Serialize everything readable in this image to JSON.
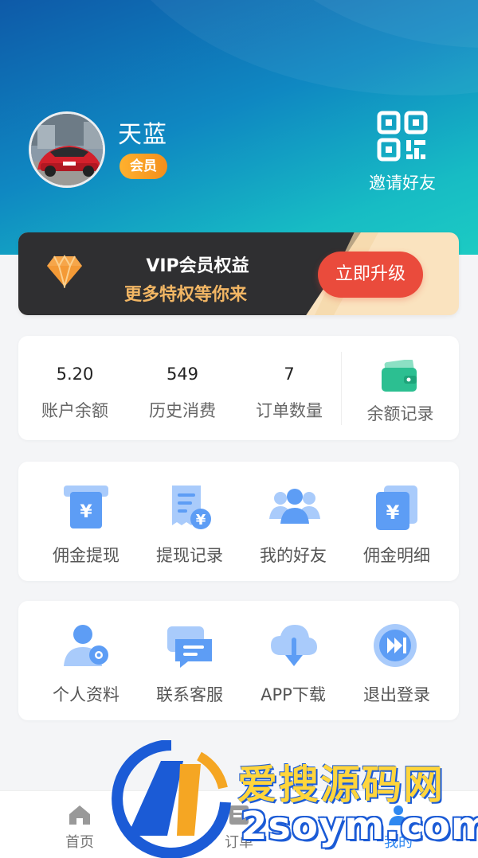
{
  "header": {
    "username": "天蓝",
    "badge": "会员",
    "invite_label": "邀请好友",
    "invite_icon": "qr-code-icon"
  },
  "vip": {
    "title": "VIP会员权益",
    "subtitle": "更多特权等你来",
    "button": "立即升级",
    "icon": "diamond-icon"
  },
  "stats": [
    {
      "value": "5.20",
      "label": "账户余额"
    },
    {
      "value": "549",
      "label": "历史消费"
    },
    {
      "value": "7",
      "label": "订单数量"
    }
  ],
  "balance_record": {
    "label": "余额记录",
    "icon": "wallet-icon"
  },
  "grid1": [
    {
      "label": "佣金提现",
      "icon": "withdraw-icon"
    },
    {
      "label": "提现记录",
      "icon": "receipt-icon"
    },
    {
      "label": "我的好友",
      "icon": "friends-icon"
    },
    {
      "label": "佣金明细",
      "icon": "commission-detail-icon"
    }
  ],
  "grid2": [
    {
      "label": "个人资料",
      "icon": "profile-icon"
    },
    {
      "label": "联系客服",
      "icon": "chat-icon"
    },
    {
      "label": "APP下载",
      "icon": "cloud-download-icon"
    },
    {
      "label": "退出登录",
      "icon": "logout-icon"
    }
  ],
  "tabbar": [
    {
      "label": "首页",
      "icon": "home-icon"
    },
    {
      "label": "订单",
      "icon": "order-icon"
    },
    {
      "label": "我的",
      "icon": "user-icon"
    }
  ],
  "watermark": {
    "cn": "爱搜源码网",
    "en": "2soym.com"
  },
  "colors": {
    "primary": "#2f88f0",
    "vip_button": "#ea4b3c",
    "vip_gold": "#f2b664",
    "badge": "#f6a024",
    "icon_blue": "#5d9df5"
  }
}
